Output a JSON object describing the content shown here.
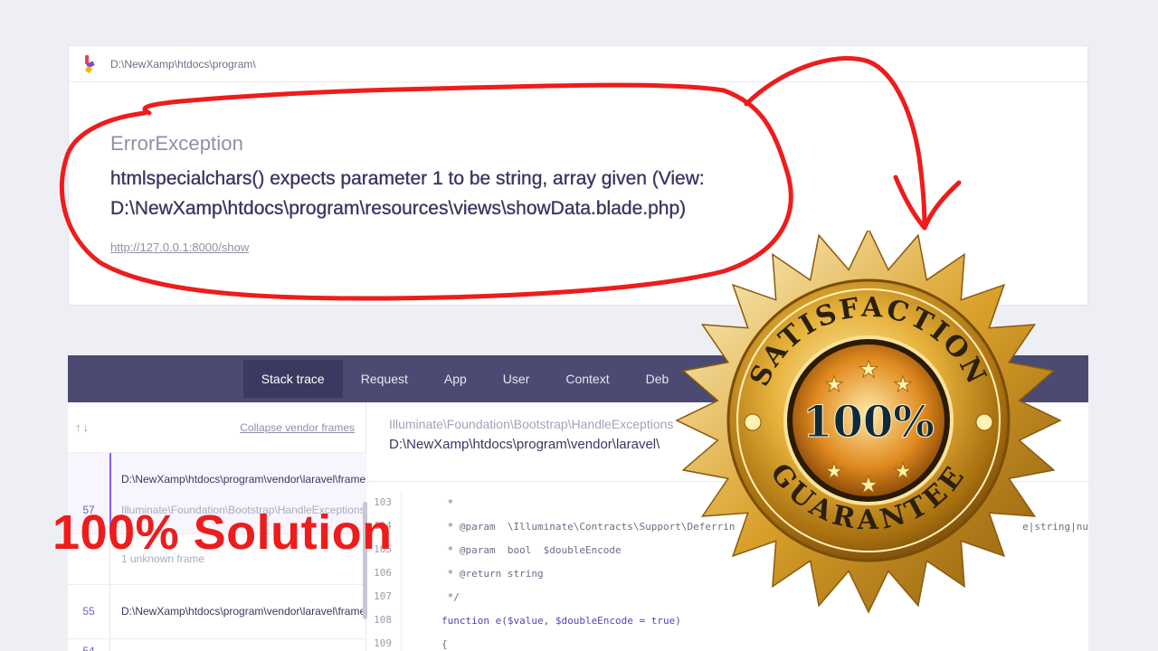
{
  "error_card": {
    "path": "D:\\NewXamp\\htdocs\\program\\",
    "exception_type": "ErrorException",
    "message_line1": "htmlspecialchars() expects parameter 1 to be string, array given (View:",
    "message_line2": "D:\\NewXamp\\htdocs\\program\\resources\\views\\showData.blade.php)",
    "url": "http://127.0.0.1:8000/show"
  },
  "tabs": [
    "Stack trace",
    "Request",
    "App",
    "User",
    "Context",
    "Deb"
  ],
  "frames_panel": {
    "collapse_label": "Collapse vendor frames",
    "frames": [
      {
        "number": "57",
        "file": "D:\\NewXamp\\htdocs\\program\\vendor\\laravel\\frame",
        "class": "Illuminate\\Foundation\\Bootstrap\\HandleExceptions"
      },
      {
        "unknown": "1 unknown frame"
      },
      {
        "number": "55",
        "file": "D:\\NewXamp\\htdocs\\program\\vendor\\laravel\\frame"
      },
      {
        "number": "54"
      }
    ]
  },
  "code": {
    "class": "Illuminate\\Foundation\\Bootstrap\\HandleExceptions",
    "file": "D:\\NewXamp\\htdocs\\program\\vendor\\laravel\\",
    "lines": [
      {
        "n": "103",
        "text": " *"
      },
      {
        "n": "104",
        "text": " * @param  \\Illuminate\\Contracts\\Support\\Deferrin"
      },
      {
        "n": "105",
        "text": " * @param  bool  $doubleEncode"
      },
      {
        "n": "106",
        "text": " * @return string"
      },
      {
        "n": "107",
        "text": " */"
      },
      {
        "n": "108",
        "text": "function e($value, $doubleEncode = true)"
      },
      {
        "n": "109",
        "text": "{"
      }
    ],
    "right_fragment": "e|string|nu"
  },
  "overlay": {
    "solution_text": "100% Solution",
    "badge_top": "SATISFACTION",
    "badge_center": "100%",
    "badge_bottom": "GUARANTEE"
  },
  "colors": {
    "tab_bar": "#4b4a72",
    "annotation_red": "#ee1c1c",
    "gold": "#d4a017"
  }
}
